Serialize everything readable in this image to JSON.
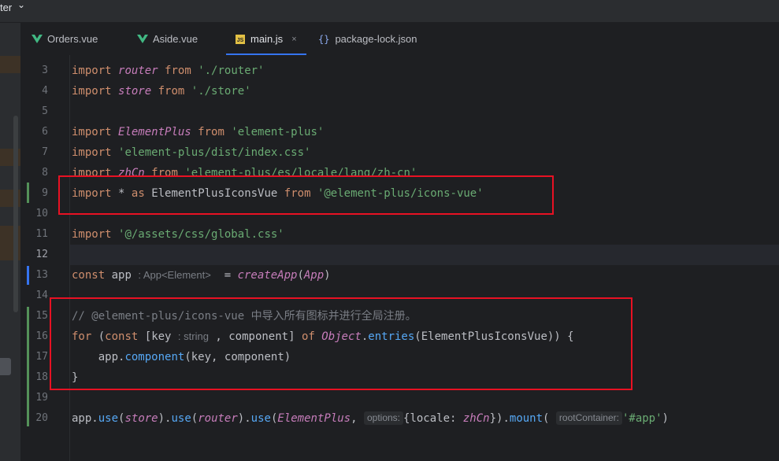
{
  "project": {
    "name_fragment": "ter",
    "chevron": "⌄"
  },
  "tabs": [
    {
      "label": "Orders.vue",
      "icon": "vue-icon"
    },
    {
      "label": "Aside.vue",
      "icon": "vue-icon"
    },
    {
      "label": "main.js",
      "icon": "js-icon",
      "badge": "JS",
      "close": "×"
    },
    {
      "label": "package-lock.json",
      "icon": "json-icon",
      "badge": "{}"
    }
  ],
  "line_numbers": [
    "3",
    "4",
    "5",
    "6",
    "7",
    "8",
    "9",
    "10",
    "11",
    "12",
    "13",
    "14",
    "15",
    "16",
    "17",
    "18",
    "19",
    "20"
  ],
  "code": {
    "l3": {
      "kw": "import",
      "name": "router",
      "from": "from",
      "str": "'./router'"
    },
    "l4": {
      "kw": "import",
      "name": "store",
      "from": "from",
      "str": "'./store'"
    },
    "l6": {
      "kw": "import",
      "name": "ElementPlus",
      "from": "from",
      "str": "'element-plus'"
    },
    "l7": {
      "kw": "import",
      "str": "'element-plus/dist/index.css'"
    },
    "l8": {
      "kw": "import",
      "name": "zhCn",
      "from": "from",
      "str": "'element-plus/es/locale/lang/zh-cn'"
    },
    "l9": {
      "kw": "import",
      "star": "*",
      "as": "as",
      "name": "ElementPlusIconsVue",
      "from": "from",
      "str": "'@element-plus/icons-vue'"
    },
    "l11": {
      "kw": "import",
      "str": "'@/assets/css/global.css'"
    },
    "l13": {
      "kw": "const",
      "name": "app",
      "hint": ": App<Element>",
      "eq": "=",
      "fn": "createApp",
      "open": "(",
      "arg": "App",
      "close": ")"
    },
    "l15": {
      "comment": "// @element-plus/icons-vue 中导入所有图标并进行全局注册。"
    },
    "l16": {
      "kw": "for",
      "p1": "(",
      "const": "const",
      "p2": "[key",
      "hint": ": string",
      "p3": ", component]",
      "of": "of",
      "obj": "Object",
      "dot": ".",
      "fn": "entries",
      "rest": "(ElementPlusIconsVue)) {"
    },
    "l17": {
      "indent": "    ",
      "obj": "app",
      "dot": ".",
      "fn": "component",
      "rest": "(key, component)"
    },
    "l18": {
      "text": "}"
    },
    "l20": {
      "obj": "app",
      "dot1": ".",
      "use1": "use",
      "p1": "(",
      "a1": "store",
      "p2": ").",
      "use2": "use",
      "p3": "(",
      "a2": "router",
      "p4": ").",
      "use3": "use",
      "p5": "(",
      "a3": "ElementPlus",
      "comma": ",",
      "hint1": "options:",
      "obj_open": "{locale: ",
      "a4": "zhCn",
      "obj_close": "}).",
      "mount": "mount",
      "p6": "(",
      "hint2": "rootContainer:",
      "str": "'#app'",
      "end": ")"
    }
  },
  "colors": {
    "keyword": "#cf8e6d",
    "string": "#6aab73",
    "italic_ident": "#c77dbb",
    "function": "#56a8f5",
    "highlight_box": "#e81123"
  }
}
